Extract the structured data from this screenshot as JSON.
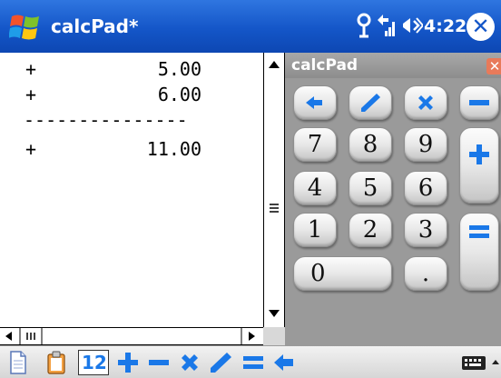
{
  "titlebar": {
    "app_title": "calcPad*",
    "clock": "4:22",
    "icons": [
      "windows-logo-icon",
      "antenna-icon",
      "signal-icon",
      "speaker-icon",
      "close-icon"
    ],
    "close_glyph": "✕"
  },
  "tape": {
    "rows": [
      {
        "op": "+",
        "value": "5.00"
      },
      {
        "op": "+",
        "value": "6.00"
      },
      {
        "separator": "---------------"
      },
      {
        "op": "+",
        "value": "11.00"
      }
    ]
  },
  "calc_panel": {
    "title": "calcPad",
    "close_glyph": "✕",
    "keys": {
      "digits": [
        "7",
        "8",
        "9",
        "4",
        "5",
        "6",
        "1",
        "2",
        "3",
        "0",
        "."
      ],
      "operators": [
        "backspace",
        "divide",
        "multiply",
        "subtract",
        "add",
        "equals"
      ]
    }
  },
  "toolbar": {
    "items": [
      "new-document-icon",
      "clipboard-icon",
      "tape-icon",
      "add-icon",
      "subtract-icon",
      "multiply-icon",
      "divide-icon",
      "equals-icon",
      "backspace-icon",
      "keyboard-icon"
    ],
    "tape_label": "12"
  },
  "colors": {
    "title_bar": "#1456c8",
    "operator_blue": "#1a78e8",
    "calc_background": "#9a9a9a"
  }
}
